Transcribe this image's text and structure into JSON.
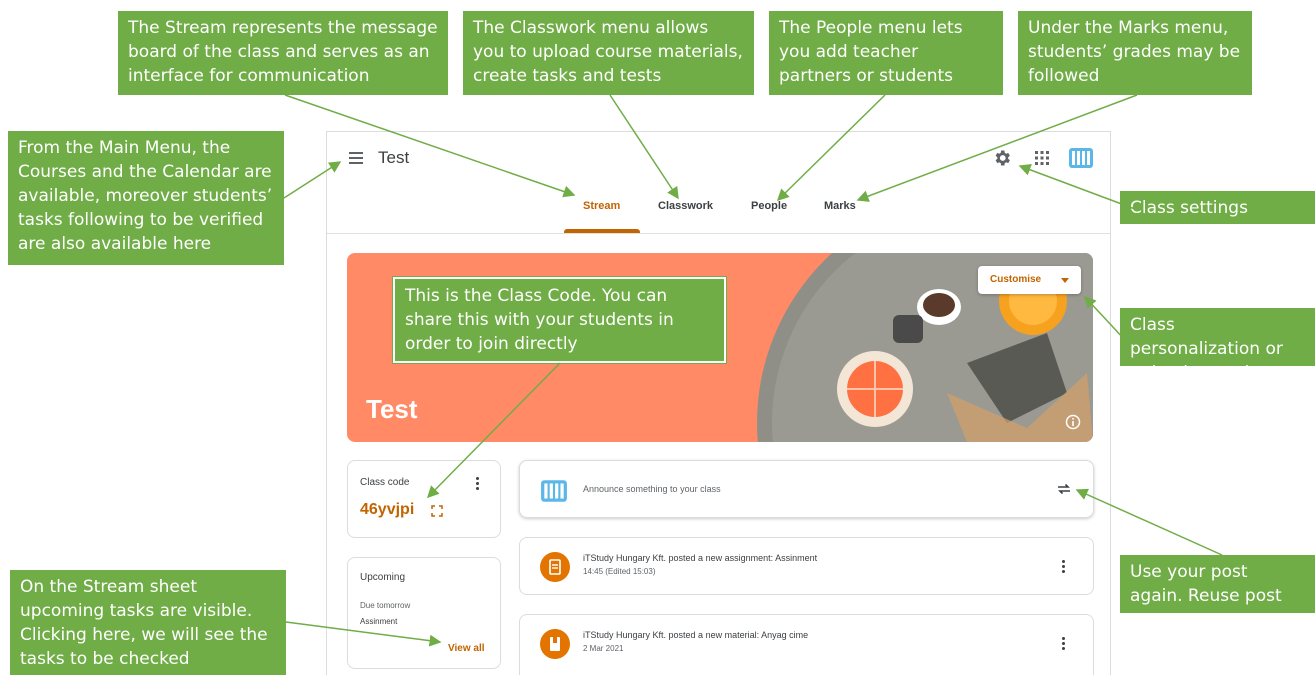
{
  "app": {
    "title": "Test",
    "tabs": [
      {
        "label": "Stream",
        "active": true
      },
      {
        "label": "Classwork",
        "active": false
      },
      {
        "label": "People",
        "active": false
      },
      {
        "label": "Marks",
        "active": false
      }
    ],
    "accent_color": "#c26401",
    "banner": {
      "title": "Test",
      "customise_label": "Customise",
      "color": "#FF8A65"
    },
    "class_code": {
      "label": "Class code",
      "value": "46yvjpi"
    },
    "upcoming": {
      "label": "Upcoming",
      "due": "Due tomorrow",
      "task": "Assinment",
      "view_all": "View all"
    },
    "announce": {
      "placeholder": "Announce something to your class"
    },
    "posts": [
      {
        "title": "iTStudy Hungary Kft. posted a new assignment: Assinment",
        "meta": "14:45 (Edited 15:03)"
      },
      {
        "title": "iTStudy Hungary Kft. posted a new material: Anyag cime",
        "meta": "2 Mar 2021"
      }
    ],
    "icons": [
      "menu-icon",
      "gear-icon",
      "apps-grid-icon",
      "classroom-logo-icon",
      "info-icon",
      "expand-icon",
      "more-vert-icon",
      "reuse-icon",
      "assignment-icon",
      "material-icon"
    ]
  },
  "callouts": {
    "stream": "The Stream represents the message board of the class and serves as an interface for communication",
    "classwork": "The Classwork menu allows you to upload course materials, create tasks and tests",
    "people": "The People menu lets you add teacher partners or students",
    "marks": "Under the Marks menu, students’ grades may be followed",
    "main_menu": "From the Main Menu, the Courses and the Calendar are available, moreover students’ tasks following to be verified are also available here",
    "class_settings": "Class settings",
    "personalization": "Class personalization or upload own photo",
    "class_code": "This is the Class Code. You can share this with your students in order to join directly",
    "reuse": "Use your post again. Reuse post",
    "upcoming": "On the Stream sheet upcoming tasks are visible. Clicking here, we will see the tasks to be checked"
  },
  "callout_color": "#70AD47"
}
